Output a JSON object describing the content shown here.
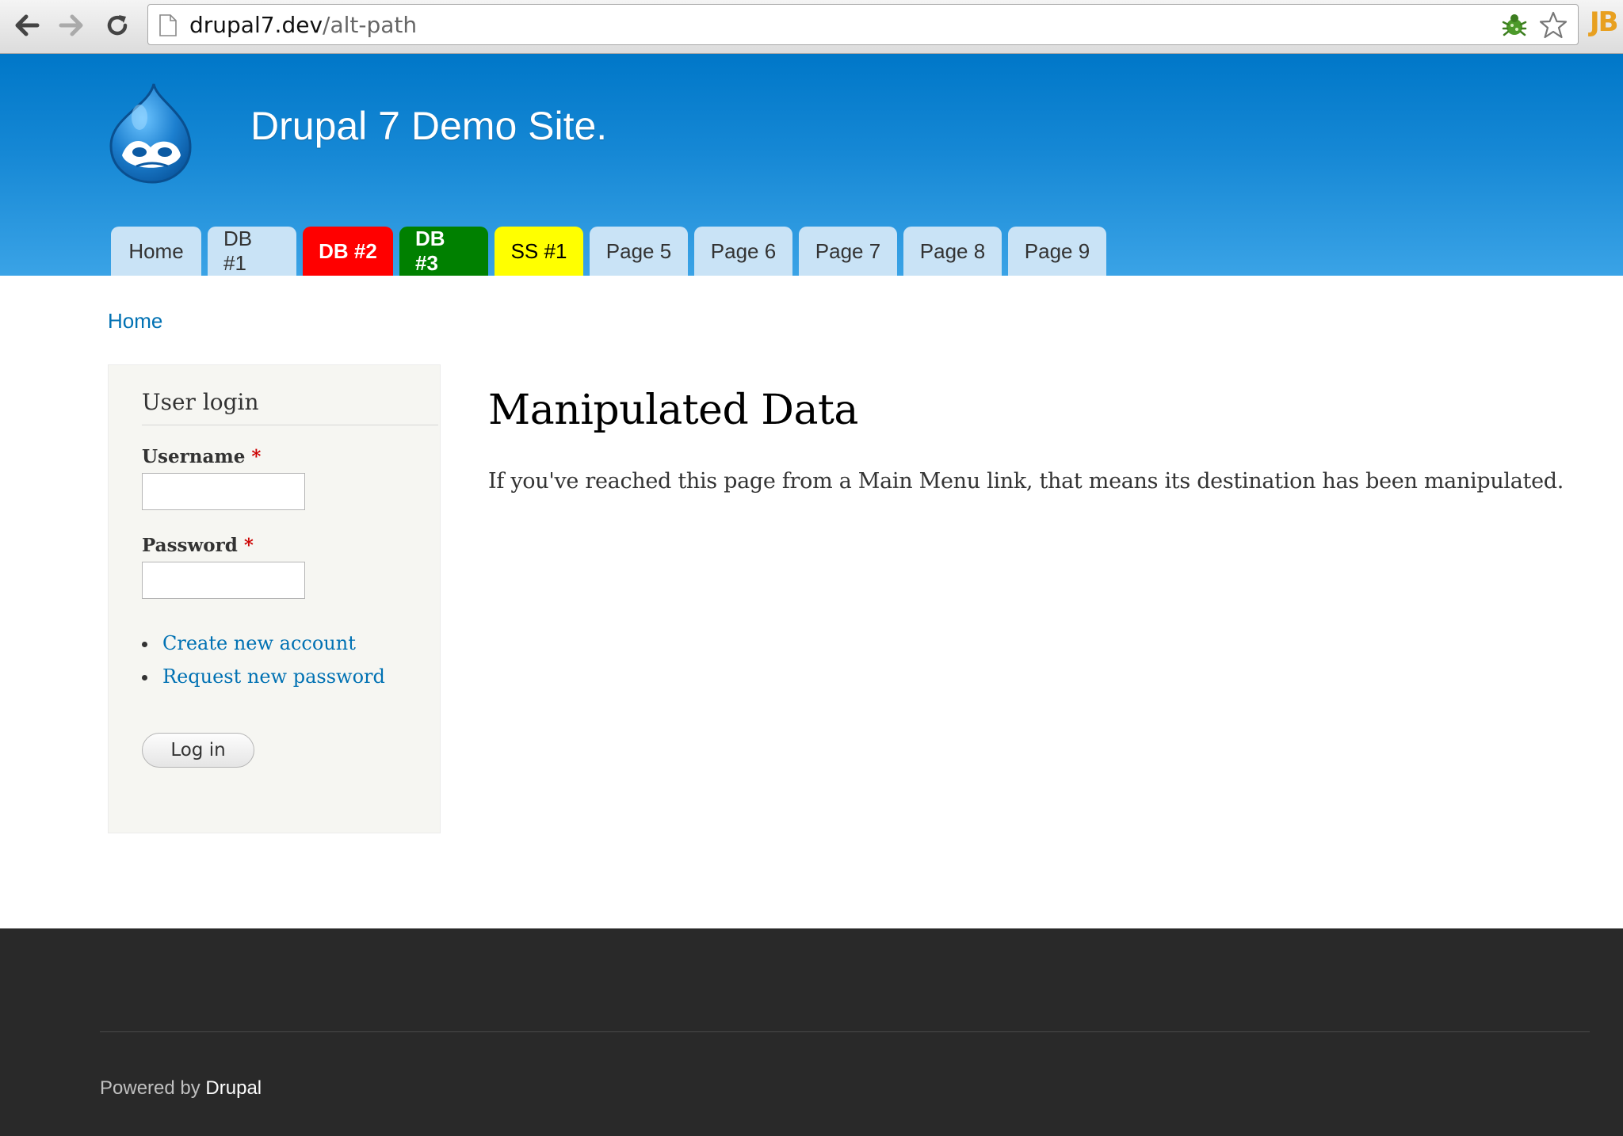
{
  "browser": {
    "url_host": "drupal7.dev",
    "url_path": "/alt-path",
    "extension_label": "JB"
  },
  "site": {
    "name": "Drupal 7 Demo Site."
  },
  "main_menu": {
    "tabs": [
      {
        "label": "Home",
        "style": "default"
      },
      {
        "label": "DB #1",
        "style": "default"
      },
      {
        "label": "DB #2",
        "style": "red"
      },
      {
        "label": "DB #3",
        "style": "green"
      },
      {
        "label": "SS #1",
        "style": "yellow"
      },
      {
        "label": "Page 5",
        "style": "default"
      },
      {
        "label": "Page 6",
        "style": "default"
      },
      {
        "label": "Page 7",
        "style": "default"
      },
      {
        "label": "Page 8",
        "style": "default"
      },
      {
        "label": "Page 9",
        "style": "default"
      }
    ]
  },
  "breadcrumb": {
    "home": "Home"
  },
  "login_block": {
    "title": "User login",
    "username_label": "Username",
    "password_label": "Password",
    "required_marker": "*",
    "username_value": "",
    "password_value": "",
    "links": [
      "Create new account",
      "Request new password"
    ],
    "submit_label": "Log in"
  },
  "content": {
    "title": "Manipulated Data",
    "body": "If you've reached this page from a Main Menu link, that means its destination has been manipulated."
  },
  "footer": {
    "powered_prefix": "Powered by",
    "powered_link": "Drupal"
  },
  "colors": {
    "header_top": "#0077c8",
    "header_bottom": "#3aa3e6",
    "tab_default": "#c9e3f6",
    "tab_red": "#ff0000",
    "tab_green": "#008000",
    "tab_yellow": "#ffff00",
    "link": "#0071b3",
    "footer_bg": "#292929"
  }
}
